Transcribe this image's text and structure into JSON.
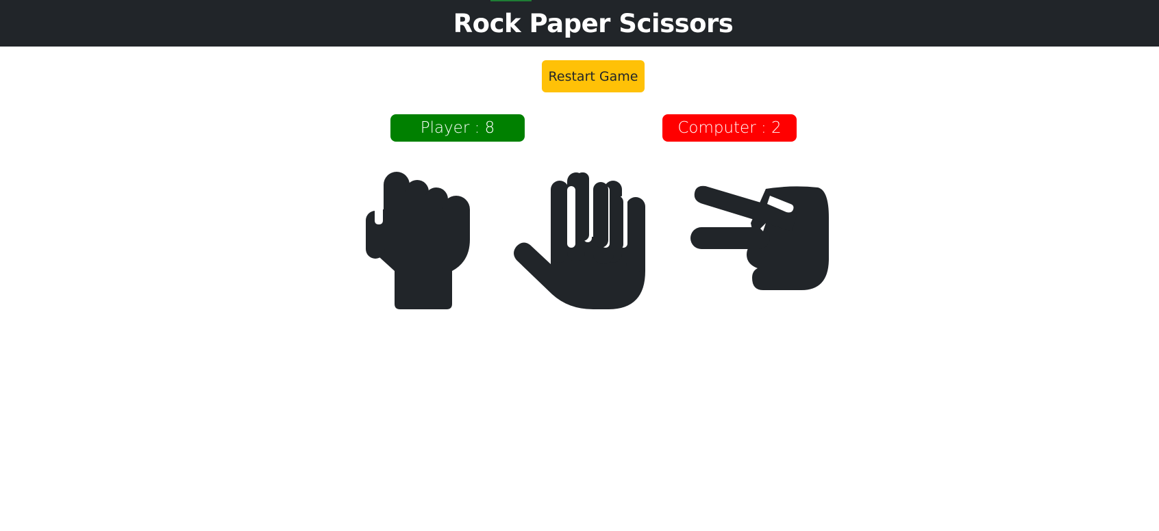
{
  "header": {
    "title": "Rock Paper Scissors"
  },
  "controls": {
    "restart_label": "Restart Game"
  },
  "scores": {
    "player_text": "Player : 8",
    "computer_text": "Computer : 2"
  },
  "choices": [
    {
      "id": "rock",
      "icon": "hand-rock-icon"
    },
    {
      "id": "paper",
      "icon": "hand-paper-icon"
    },
    {
      "id": "scissors",
      "icon": "hand-scissors-icon"
    }
  ],
  "colors": {
    "navbar": "#212529",
    "restart_button": "#ffc107",
    "player_badge": "#008000",
    "computer_badge": "#ff0000",
    "icon": "#212529"
  }
}
